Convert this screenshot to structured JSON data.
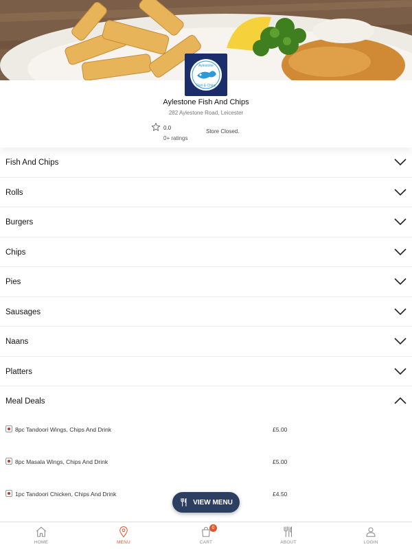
{
  "store": {
    "name": "Aylestone Fish And Chips",
    "address": "282 Aylestone Road, Leicester",
    "rating": "0.0",
    "ratings_count": "0+ ratings",
    "status": "Store Closed.",
    "logo_text_top": "Aylestone",
    "logo_text_bottom": "Fish & Chips"
  },
  "categories": [
    {
      "label": "Fish And Chips",
      "expanded": false
    },
    {
      "label": "Rolls",
      "expanded": false
    },
    {
      "label": "Burgers",
      "expanded": false
    },
    {
      "label": "Chips",
      "expanded": false
    },
    {
      "label": "Pies",
      "expanded": false
    },
    {
      "label": "Sausages",
      "expanded": false
    },
    {
      "label": "Naans",
      "expanded": false
    },
    {
      "label": "Platters",
      "expanded": false
    },
    {
      "label": "Meal Deals",
      "expanded": true
    }
  ],
  "meal_deals": [
    {
      "name": "8pc Tandoori Wings, Chips And Drink",
      "price": "£5.00"
    },
    {
      "name": "8pc Masala Wings, Chips And Drink",
      "price": "£5.00"
    },
    {
      "name": "1pc Tandoori Chicken, Chips And Drink",
      "price": "£4.50"
    }
  ],
  "view_menu_button": {
    "label": "VIEW MENU",
    "icon": "cutlery-icon"
  },
  "bottom_nav": [
    {
      "label": "HOME",
      "icon": "home-icon",
      "active": false
    },
    {
      "label": "MENU",
      "icon": "location-pin-icon",
      "active": true
    },
    {
      "label": "CART",
      "icon": "cart-bag-icon",
      "active": false,
      "badge": "0"
    },
    {
      "label": "ABOUT",
      "icon": "cutlery-icon",
      "active": false
    },
    {
      "label": "LOGIN",
      "icon": "user-icon",
      "active": false
    }
  ],
  "colors": {
    "accent": "#e0562b",
    "button": "#2d3e63",
    "logo_bg": "#1c2d6b"
  }
}
